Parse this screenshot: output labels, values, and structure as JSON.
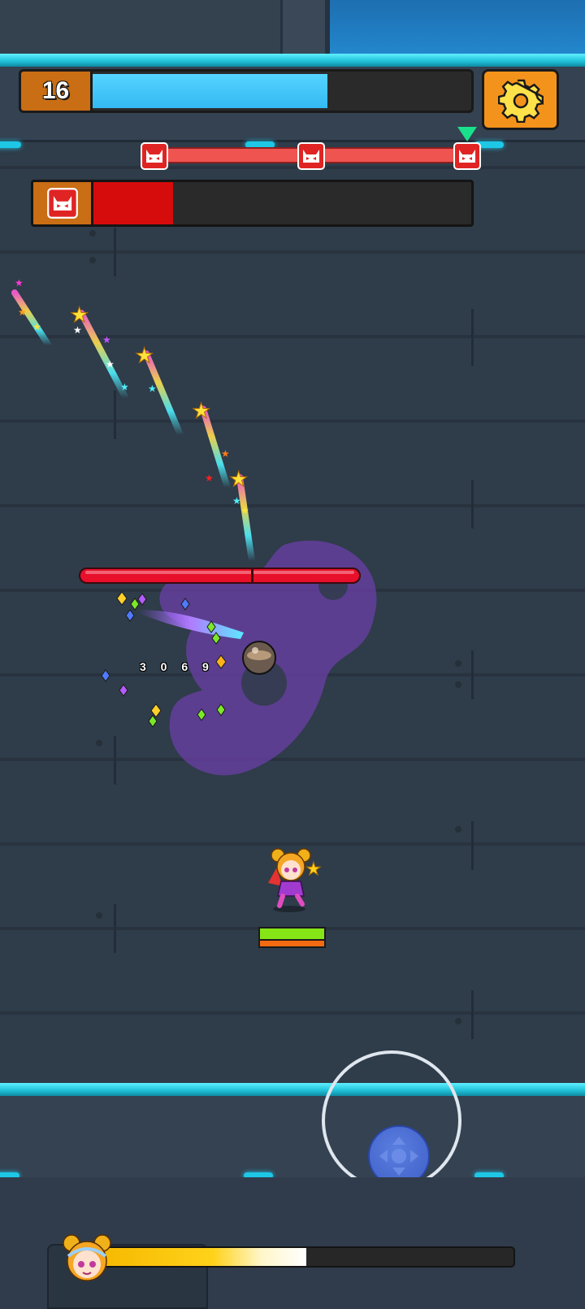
{
  "hud": {
    "level": "16",
    "xp_progress": 0.62,
    "stage_progress": 1.0,
    "boss_hp_fraction": 0.21
  },
  "combat": {
    "damage_number": "3 0 6 9",
    "enemy_hp_fraction": 1.0,
    "player_hp_fraction": 1.0,
    "player_shield_fraction": 1.0
  },
  "skill": {
    "charge_fraction": 0.5
  },
  "colors": {
    "accent_orange": "#f4931b",
    "xp_blue": "#33b9f2",
    "boss_red": "#d60b0b",
    "rail_cyan": "#22c3db"
  },
  "icons": [
    "gear-icon",
    "boss-skull-icon",
    "stage-marker-icon",
    "joystick-icon",
    "hero-avatar-icon"
  ]
}
